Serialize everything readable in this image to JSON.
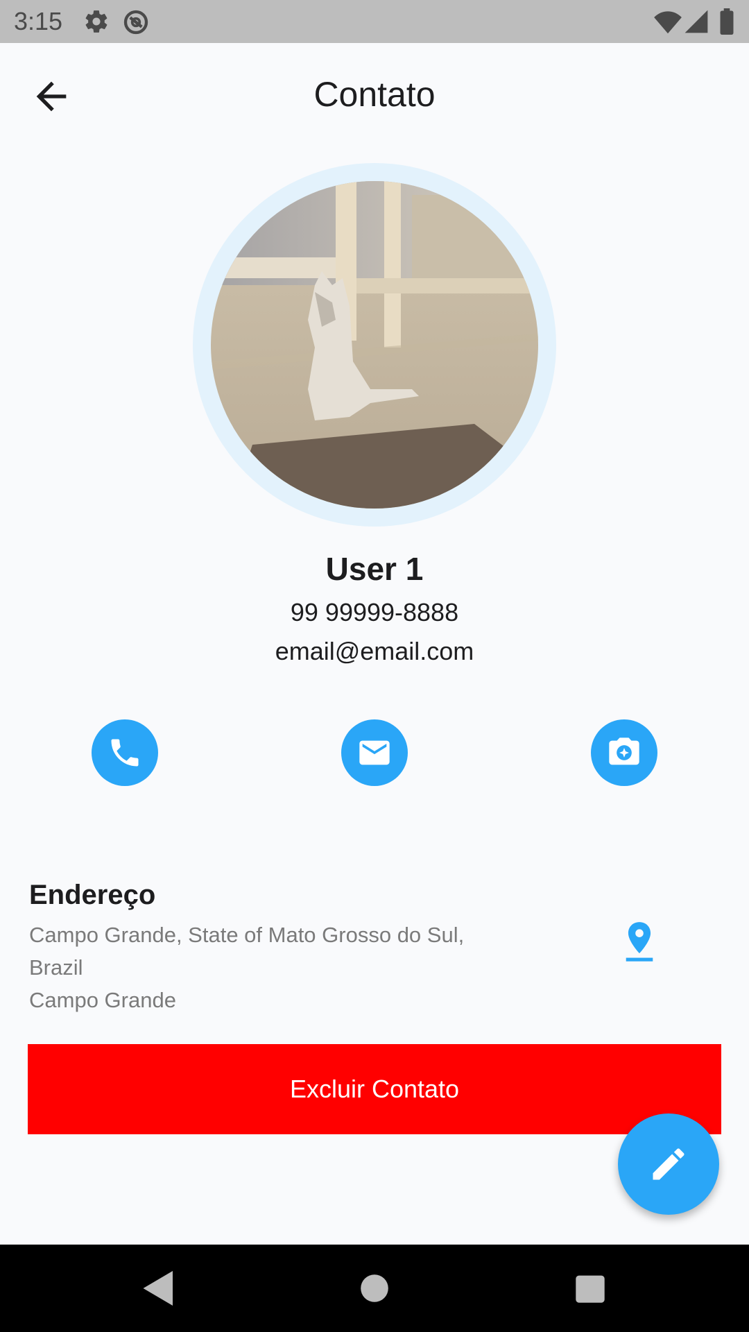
{
  "status_bar": {
    "time": "3:15",
    "icons": [
      "settings-icon",
      "do-not-disturb-icon",
      "wifi-icon",
      "signal-icon",
      "battery-icon"
    ]
  },
  "app_bar": {
    "title": "Contato",
    "back_icon": "arrow-back-icon"
  },
  "contact": {
    "name": "User 1",
    "phone": "99 99999-8888",
    "email": "email@email.com"
  },
  "actions": [
    {
      "icon": "phone-icon"
    },
    {
      "icon": "email-icon"
    },
    {
      "icon": "camera-icon"
    }
  ],
  "address": {
    "title": "Endereço",
    "line1": "Campo Grande, State of Mato Grosso do Sul,",
    "line2": "Brazil",
    "line3": "Campo Grande",
    "icon": "map-pin-icon"
  },
  "delete_button": {
    "label": "Excluir Contato"
  },
  "fab": {
    "icon": "edit-pencil-icon"
  },
  "nav_bar": {
    "icons": [
      "nav-back-icon",
      "nav-home-icon",
      "nav-recents-icon"
    ]
  },
  "colors": {
    "accent": "#2aa6f7",
    "danger": "#ff0000",
    "background": "#f9fafc",
    "avatar_ring": "#e3f2fc"
  }
}
